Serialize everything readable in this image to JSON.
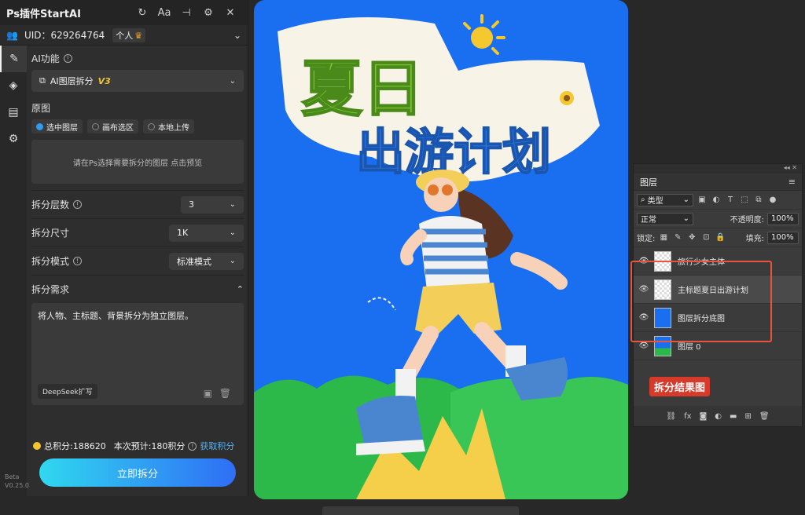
{
  "plugin": {
    "title": "Ps插件StartAI",
    "user": {
      "uid_label": "UID：629264764",
      "badge": "个人"
    },
    "ai_function_label": "AI功能",
    "ai_function_value": "AI图层拆分",
    "ai_function_version": "V3",
    "source_label": "原图",
    "source_options": [
      "选中图层",
      "画布选区",
      "本地上传"
    ],
    "source_hint": "请在Ps选择需要拆分的图层 点击预览",
    "layers_count_label": "拆分层数",
    "layers_count_value": "3",
    "size_label": "拆分尺寸",
    "size_value": "1K",
    "mode_label": "拆分模式",
    "mode_value": "标准模式",
    "req_label": "拆分需求",
    "req_text": "将人物、主标题、背景拆分为独立图层。",
    "deepseek_label": "DeepSeek扩写",
    "points_text": "总积分:188620",
    "estimate_text": "本次预计:180积分",
    "get_points": "获取积分",
    "split_button": "立即拆分",
    "beta": "Beta",
    "version": "V0.25.0"
  },
  "artwork": {
    "title_line1": "夏日",
    "title_line2": "出游计划",
    "accent_color": "#1a6ff0"
  },
  "layers_panel": {
    "tab": "图层",
    "filter": "类型",
    "blend": "正常",
    "opacity_label": "不透明度:",
    "opacity_value": "100%",
    "lock_label": "锁定:",
    "fill_label": "填充:",
    "fill_value": "100%",
    "layers": [
      {
        "name": "旅行少女主体"
      },
      {
        "name": "主标题夏日出游计划"
      },
      {
        "name": "图层拆分底图"
      },
      {
        "name": "图层 0"
      }
    ],
    "result_label": "拆分结果图"
  }
}
